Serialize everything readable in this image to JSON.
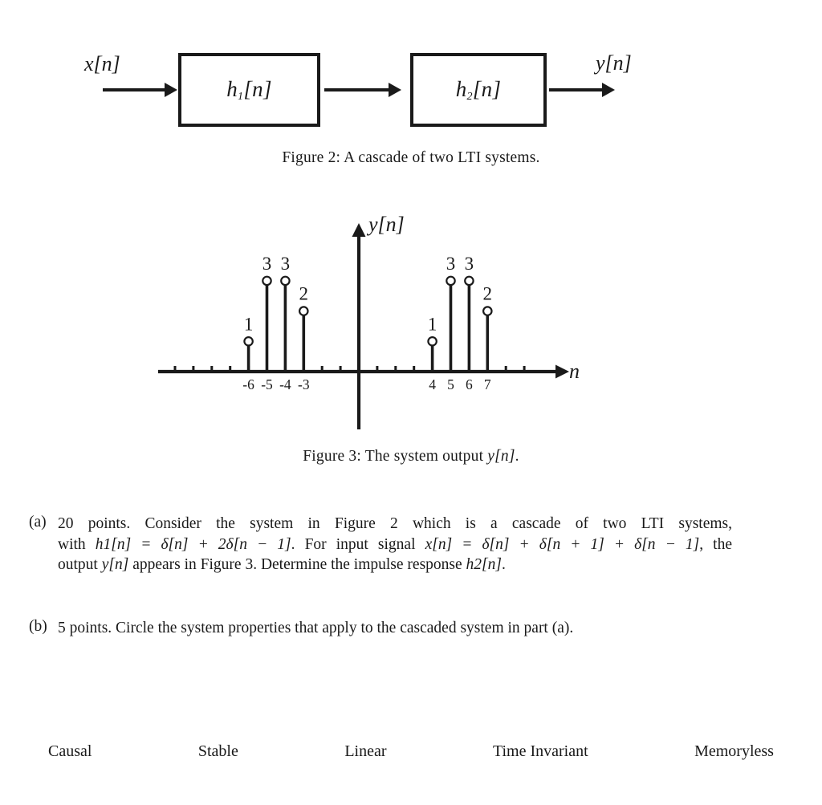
{
  "figure2": {
    "input_label": "x[n]",
    "output_label": "y[n]",
    "block1_label": "h1[n]",
    "block2_label": "h2[n]",
    "caption": "Figure 2:  A cascade of two LTI systems."
  },
  "figure3": {
    "caption_prefix": "Figure 3:  The system output ",
    "caption_math": "y[n]",
    "caption_suffix": ".",
    "y_axis_label": "y[n]",
    "x_axis_label": "n"
  },
  "chart_data": {
    "type": "stem",
    "title": "",
    "xlabel": "n",
    "ylabel": "y[n]",
    "xlim": [
      -10.5,
      9.8
    ],
    "ylim": [
      0,
      3.6
    ],
    "grid": false,
    "legend": null,
    "x": [
      -6,
      -5,
      -4,
      -3,
      4,
      5,
      6,
      7
    ],
    "values": [
      1,
      3,
      3,
      2,
      1,
      3,
      3,
      2
    ],
    "point_labels": [
      "1",
      "3",
      "3",
      "2",
      "1",
      "3",
      "3",
      "2"
    ],
    "tick_values": [
      -10,
      -9,
      -8,
      -7,
      -6,
      -5,
      -4,
      -3,
      -2,
      -1,
      1,
      2,
      3,
      4,
      5,
      6,
      7,
      8,
      9
    ],
    "labeled_ticks": [
      {
        "x": -6,
        "label": "-6"
      },
      {
        "x": -5,
        "label": "-5"
      },
      {
        "x": -4,
        "label": "-4"
      },
      {
        "x": -3,
        "label": "-3"
      },
      {
        "x": 4,
        "label": "4"
      },
      {
        "x": 5,
        "label": "5"
      },
      {
        "x": 6,
        "label": "6"
      },
      {
        "x": 7,
        "label": "7"
      }
    ],
    "marker": "open-circle",
    "stroke_color": "#1a1a1a"
  },
  "question_a": {
    "label": "(a)",
    "line1": "20 points.  Consider the system in Figure 2 which is a cascade of two LTI systems,",
    "line2_pre": "with ",
    "line2_math1": "h1[n] = δ[n] + 2δ[n − 1]",
    "line2_mid": ". For input signal ",
    "line2_math2": "x[n] = δ[n] + δ[n + 1] + δ[n − 1]",
    "line2_post": ", the",
    "line3_pre": "output ",
    "line3_math1": "y[n]",
    "line3_mid": " appears in Figure 3. Determine the impulse response ",
    "line3_math2": "h2[n]",
    "line3_post": "."
  },
  "question_b": {
    "label": "(b)",
    "text": "5 points. Circle the system properties that apply to the cascaded system in part (a)."
  },
  "properties": [
    "Causal",
    "Stable",
    "Linear",
    "Time Invariant",
    "Memoryless"
  ],
  "colors": {
    "ink": "#1a1a1a",
    "background": "#ffffff"
  }
}
